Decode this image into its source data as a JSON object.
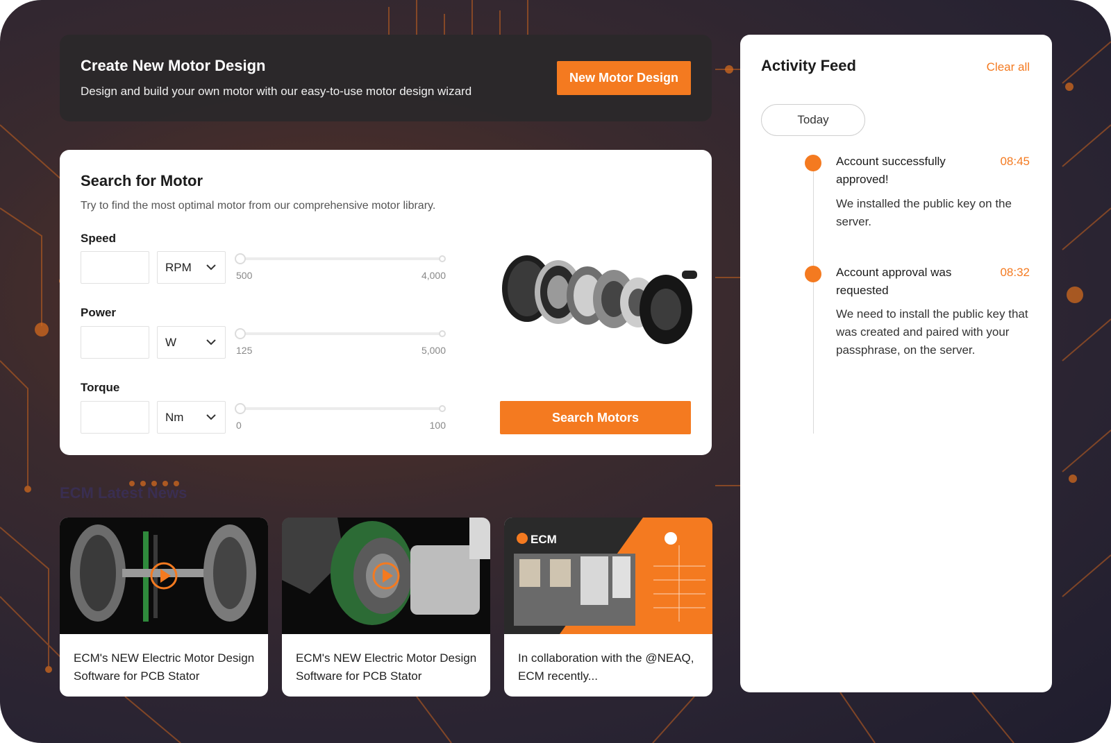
{
  "create": {
    "title": "Create New Motor Design",
    "description": "Design and build your own motor with our easy-to-use motor design wizard",
    "button_label": "New Motor Design"
  },
  "search": {
    "title": "Search for Motor",
    "description": "Try to find the most optimal motor from our comprehensive motor library.",
    "fields": [
      {
        "label": "Speed",
        "unit": "RPM",
        "min": "500",
        "max": "4,000"
      },
      {
        "label": "Power",
        "unit": "W",
        "min": "125",
        "max": "5,000"
      },
      {
        "label": "Torque",
        "unit": "Nm",
        "min": "0",
        "max": "100"
      }
    ],
    "button_label": "Search Motors"
  },
  "news": {
    "heading": "ECM Latest News",
    "items": [
      {
        "text": "ECM's NEW Electric Motor Design Software for PCB Stator"
      },
      {
        "text": "ECM's NEW Electric Motor Design Software for PCB Stator"
      },
      {
        "text": "In collaboration with the @NEAQ, ECM recently..."
      }
    ],
    "thumb3_logo": "ECM"
  },
  "activity": {
    "title": "Activity Feed",
    "clear_label": "Clear all",
    "group_label": "Today",
    "events": [
      {
        "title": "Account successfully approved!",
        "time": "08:45",
        "description": "We installed the public key on the server."
      },
      {
        "title": "Account approval was requested",
        "time": "08:32",
        "description": "We need to install the public key that was created and paired with your passphrase, on the server."
      }
    ]
  },
  "colors": {
    "accent": "#f47a20",
    "panel_dark": "#2a282a"
  },
  "icons": [
    "chevron-down-icon",
    "play-icon",
    "motor-exploded-image",
    "ecm-logo"
  ]
}
